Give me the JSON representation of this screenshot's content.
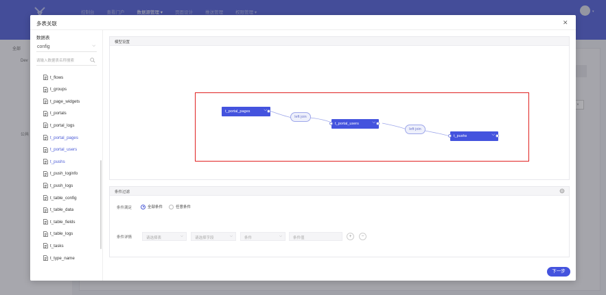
{
  "app": {
    "nav": [
      {
        "label": "控制台",
        "active": false
      },
      {
        "label": "查看门户",
        "active": false
      },
      {
        "label": "数据源管理 ▾",
        "active": true
      },
      {
        "label": "页面设计",
        "active": false
      },
      {
        "label": "推送管理",
        "active": false
      },
      {
        "label": "权限管理 ▾",
        "active": false
      }
    ],
    "sidebar_bg": [
      "全部",
      "Dev",
      "公共"
    ]
  },
  "modal": {
    "title": "多表关联",
    "left": {
      "title": "数据表",
      "db_value": "config",
      "search_placeholder": "请输入数据表名称搜索",
      "tables": [
        {
          "name": "t_flows",
          "selected": false
        },
        {
          "name": "t_groups",
          "selected": false
        },
        {
          "name": "t_page_widgets",
          "selected": false
        },
        {
          "name": "t_portals",
          "selected": false
        },
        {
          "name": "t_portal_logs",
          "selected": false
        },
        {
          "name": "t_portal_pages",
          "selected": true
        },
        {
          "name": "t_portal_users",
          "selected": true
        },
        {
          "name": "t_pushs",
          "selected": true
        },
        {
          "name": "t_push_loginfo",
          "selected": false
        },
        {
          "name": "t_push_logs",
          "selected": false
        },
        {
          "name": "t_table_config",
          "selected": false
        },
        {
          "name": "t_table_data",
          "selected": false
        },
        {
          "name": "t_table_fields",
          "selected": false
        },
        {
          "name": "t_table_logs",
          "selected": false
        },
        {
          "name": "t_tasks",
          "selected": false
        },
        {
          "name": "t_type_name",
          "selected": false
        }
      ]
    },
    "model": {
      "title": "模型设置",
      "nodes": [
        "t_portal_pages",
        "t_portal_users",
        "t_pushs"
      ],
      "joins": [
        "left join",
        "left join"
      ]
    },
    "filter": {
      "title": "条件过滤",
      "match_label": "条件满足",
      "options": [
        {
          "label": "全部条件",
          "checked": true
        },
        {
          "label": "任意条件",
          "checked": false
        }
      ],
      "detail_label": "条件详情",
      "selects": [
        "请选择表",
        "请选择字段",
        "条件",
        "条件值"
      ],
      "add": "+",
      "remove": "−"
    },
    "next_label": "下一步"
  },
  "colors": {
    "primary": "#4453de",
    "highlight": "#e0201f"
  }
}
